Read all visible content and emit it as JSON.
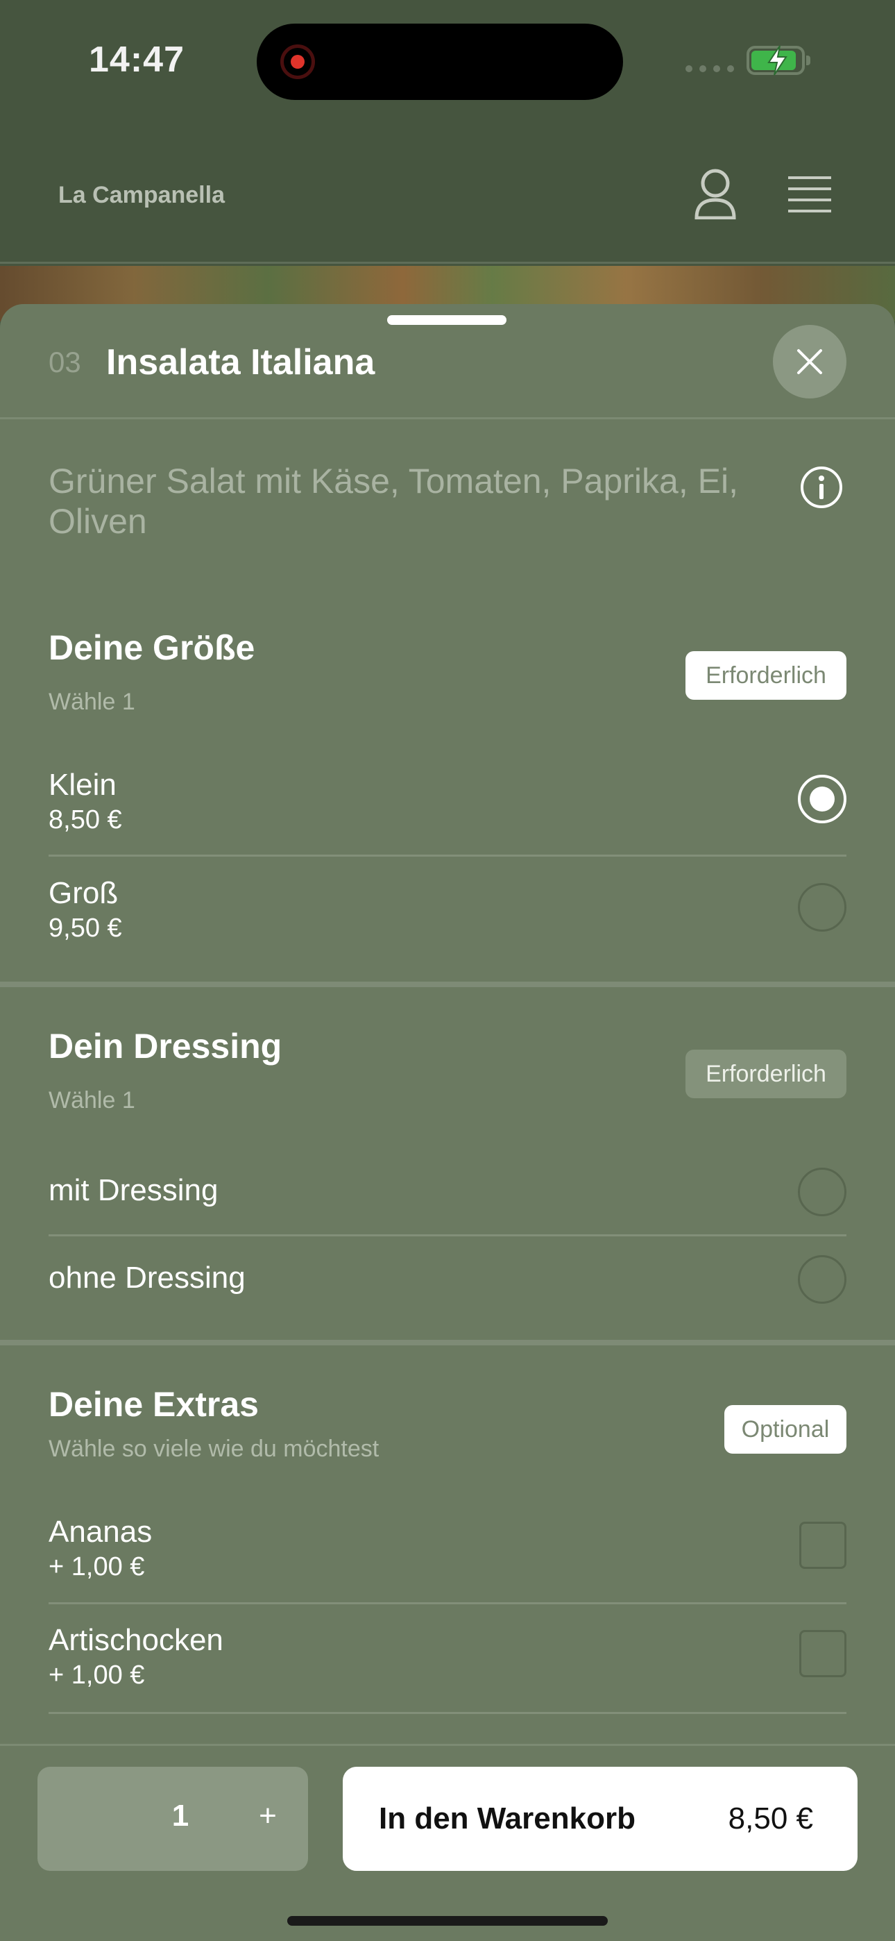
{
  "status_bar": {
    "time": "14:47"
  },
  "header": {
    "brand": "La Campanella"
  },
  "item": {
    "number": "03",
    "title": "Insalata Italiana",
    "description": "Grüner Salat mit Käse, Tomaten, Paprika, Ei, Oliven"
  },
  "sections": [
    {
      "title": "Deine Größe",
      "subtitle": "Wähle 1",
      "badge": "Erforderlich",
      "options": [
        {
          "label": "Klein",
          "price": "8,50 €",
          "selected": true
        },
        {
          "label": "Groß",
          "price": "9,50 €",
          "selected": false
        }
      ]
    },
    {
      "title": "Dein Dressing",
      "subtitle": "Wähle 1",
      "badge": "Erforderlich",
      "options": [
        {
          "label": "mit Dressing",
          "selected": false
        },
        {
          "label": "ohne Dressing",
          "selected": false
        }
      ]
    },
    {
      "title": "Deine Extras",
      "subtitle": "Wähle so viele wie du möchtest",
      "badge": "Optional",
      "options": [
        {
          "label": "Ananas",
          "price": "+ 1,00 €",
          "checked": false
        },
        {
          "label": "Artischocken",
          "price": "+ 1,00 €",
          "checked": false
        }
      ]
    }
  ],
  "footer": {
    "quantity": "1",
    "plus_label": "+",
    "cart_label": "In den Warenkorb",
    "cart_price": "8,50 €"
  },
  "colors": {
    "sheet_bg": "#6b7a61",
    "backdrop": "#46553f",
    "accent_white": "#ffffff",
    "battery_green": "#3fb54a",
    "record_red": "#e0342b"
  },
  "icons": [
    "record-icon",
    "battery-icon",
    "user-icon",
    "menu-icon",
    "close-icon",
    "info-icon",
    "radio-icon",
    "checkbox-icon"
  ]
}
